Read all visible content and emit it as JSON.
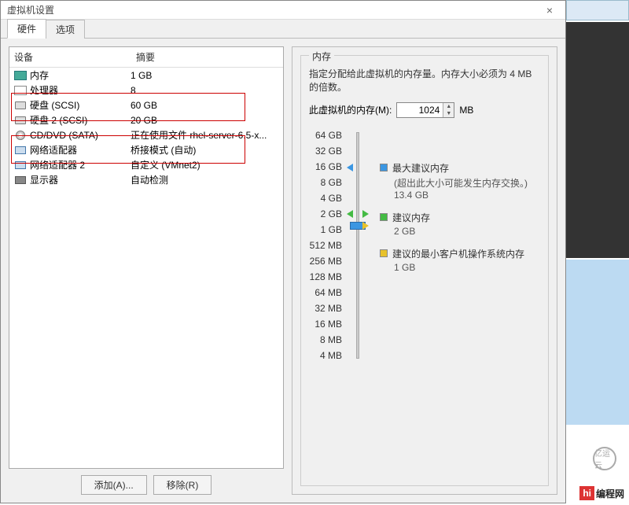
{
  "window": {
    "title": "虚拟机设置",
    "close": "×"
  },
  "tabs": {
    "hardware": "硬件",
    "options": "选项"
  },
  "headers": {
    "device": "设备",
    "summary": "摘要"
  },
  "devices": [
    {
      "name": "内存",
      "summary": "1 GB",
      "icon": "mem"
    },
    {
      "name": "处理器",
      "summary": "8",
      "icon": "cpu"
    },
    {
      "name": "硬盘 (SCSI)",
      "summary": "60 GB",
      "icon": "hdd"
    },
    {
      "name": "硬盘 2 (SCSI)",
      "summary": "20 GB",
      "icon": "hdd"
    },
    {
      "name": "CD/DVD (SATA)",
      "summary": "正在使用文件 rhel-server-6.5-x...",
      "icon": "cd"
    },
    {
      "name": "网络适配器",
      "summary": "桥接模式 (自动)",
      "icon": "net"
    },
    {
      "name": "网络适配器 2",
      "summary": "自定义 (VMnet2)",
      "icon": "net"
    },
    {
      "name": "显示器",
      "summary": "自动检测",
      "icon": "disp"
    }
  ],
  "buttons": {
    "add": "添加(A)...",
    "remove": "移除(R)"
  },
  "mem": {
    "group": "内存",
    "desc": "指定分配给此虚拟机的内存量。内存大小必须为 4 MB 的倍数。",
    "label": "此虚拟机的内存(M):",
    "value": "1024",
    "unit": "MB"
  },
  "ticks": [
    "64 GB",
    "32 GB",
    "16 GB",
    "8 GB",
    "4 GB",
    "2 GB",
    "1 GB",
    "512 MB",
    "256 MB",
    "128 MB",
    "64 MB",
    "32 MB",
    "16 MB",
    "8 MB",
    "4 MB"
  ],
  "legend": {
    "max": {
      "title": "最大建议内存",
      "sub": "(超出此大小可能发生内存交换。)",
      "val": "13.4 GB",
      "color": "#3b96e2"
    },
    "rec": {
      "title": "建议内存",
      "val": "2 GB",
      "color": "#4b4"
    },
    "min": {
      "title": "建议的最小客户机操作系统内存",
      "val": "1 GB",
      "color": "#e8c22b"
    }
  },
  "brand": {
    "l1": "hi",
    "l2": "编程网"
  },
  "wm": "亿运云"
}
